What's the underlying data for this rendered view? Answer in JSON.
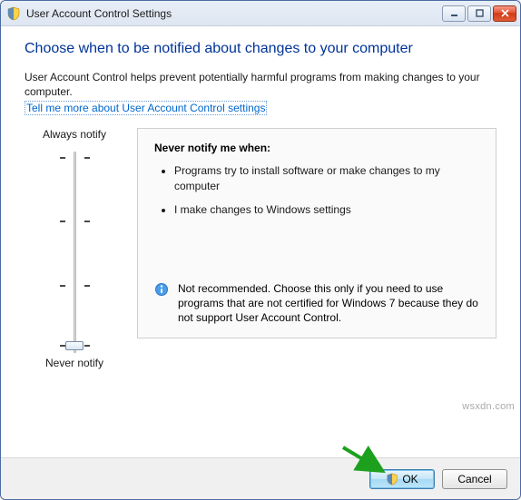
{
  "titlebar": {
    "title": "User Account Control Settings"
  },
  "content": {
    "heading": "Choose when to be notified about changes to your computer",
    "intro": "User Account Control helps prevent potentially harmful programs from making changes to your computer.",
    "link": "Tell me more about User Account Control settings"
  },
  "slider": {
    "top_label": "Always notify",
    "bottom_label": "Never notify",
    "levels": 4,
    "position": 0
  },
  "explain": {
    "title": "Never notify me when:",
    "bullets": [
      "Programs try to install software or make changes to my computer",
      "I make changes to Windows settings"
    ],
    "recommendation": "Not recommended. Choose this only if you need to use programs that are not certified for Windows 7 because they do not support User Account Control."
  },
  "footer": {
    "ok_label": "OK",
    "cancel_label": "Cancel"
  },
  "watermark": "wsxdn.com"
}
